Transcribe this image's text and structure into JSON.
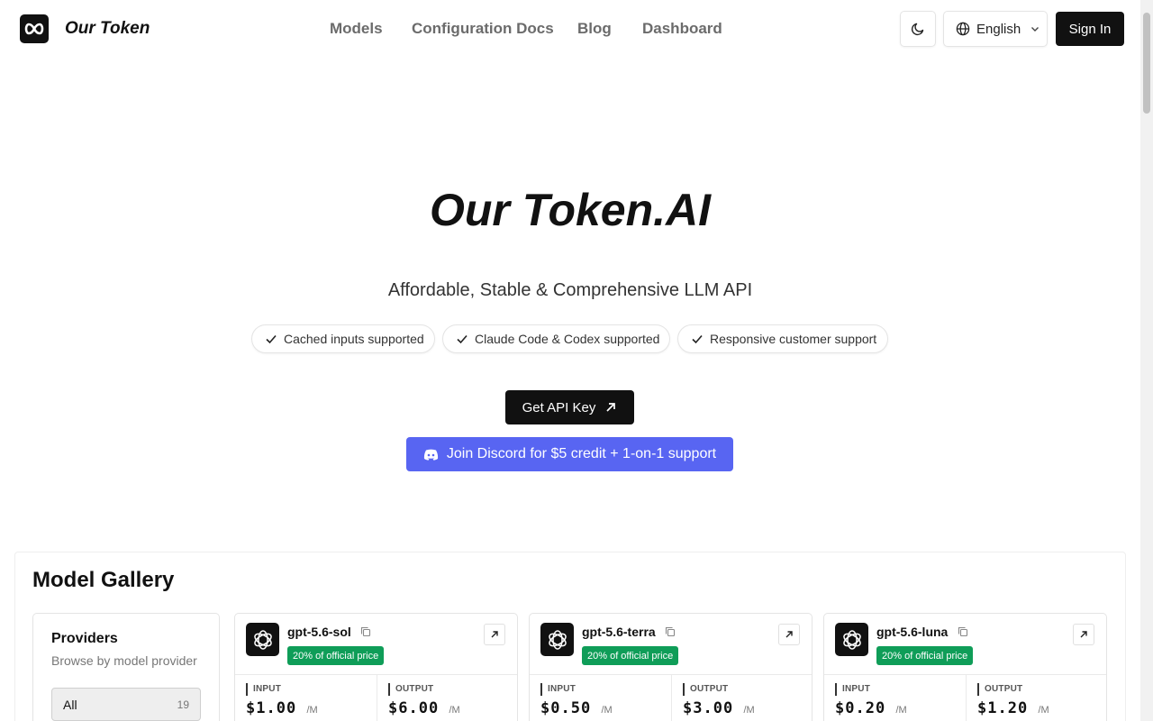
{
  "header": {
    "brand": "Our Token",
    "nav": [
      "Models",
      "Configuration Docs",
      "Blog",
      "Dashboard"
    ],
    "language": "English",
    "sign_in": "Sign In"
  },
  "hero": {
    "title": "Our Token.AI",
    "subtitle": "Affordable, Stable & Comprehensive LLM API",
    "features": [
      "Cached inputs supported",
      "Claude Code & Codex supported",
      "Responsive customer support"
    ],
    "api_button": "Get API Key",
    "discord_button": "Join Discord for $5 credit + 1-on-1 support"
  },
  "gallery": {
    "title": "Model Gallery",
    "providers": {
      "title": "Providers",
      "subtitle": "Browse by model provider",
      "all_label": "All",
      "all_count": "19"
    },
    "models": [
      {
        "name": "gpt-5.6-sol",
        "badge": "20% of official price",
        "input_label": "INPUT",
        "input_price": "$1.00",
        "input_unit": "/M",
        "output_label": "OUTPUT",
        "output_price": "$6.00",
        "output_unit": "/M"
      },
      {
        "name": "gpt-5.6-terra",
        "badge": "20% of official price",
        "input_label": "INPUT",
        "input_price": "$0.50",
        "input_unit": "/M",
        "output_label": "OUTPUT",
        "output_price": "$3.00",
        "output_unit": "/M"
      },
      {
        "name": "gpt-5.6-luna",
        "badge": "20% of official price",
        "input_label": "INPUT",
        "input_price": "$0.20",
        "input_unit": "/M",
        "output_label": "OUTPUT",
        "output_price": "$1.20",
        "output_unit": "/M"
      }
    ]
  },
  "colors": {
    "accent": "#111111",
    "discord": "#5865f2",
    "badge": "#0f9d58"
  },
  "icons": [
    "infinity-logo-icon",
    "moon-icon",
    "globe-icon",
    "chevron-down-icon",
    "check-icon",
    "arrow-up-right-icon",
    "discord-icon",
    "openai-icon",
    "copy-icon",
    "external-link-icon"
  ]
}
